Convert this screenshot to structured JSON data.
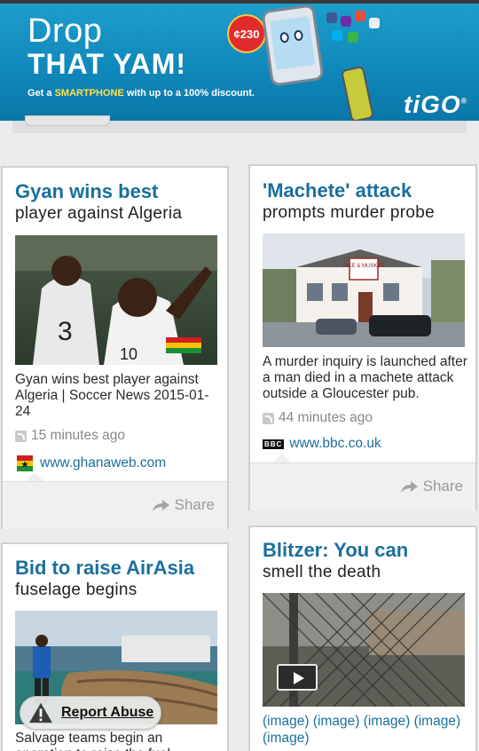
{
  "ad": {
    "headline1": "Drop",
    "headline2": "THAT YAM!",
    "tagline_pre": "Get a",
    "tagline_bold": "SMARTPHONE",
    "tagline_post": "with up to a 100% discount.",
    "price": "¢230",
    "brand": "tiGO",
    "brand_mark": "®"
  },
  "cards": [
    {
      "title": "Gyan wins best",
      "subtitle": "player against Algeria",
      "description": "Gyan wins best player against Algeria | Soccer News 2015-01-24",
      "time": "15 minutes ago",
      "source": "www.ghanaweb.com",
      "share": "Share"
    },
    {
      "title": "'Machete' attack",
      "subtitle": "prompts murder probe",
      "photo_sign": "PIKE & MUSKET",
      "description": "A murder inquiry is launched after a man died in a machete attack outside a Gloucester pub.",
      "time": "44 minutes ago",
      "source_logo": "BBC",
      "source": "www.bbc.co.uk",
      "share": "Share"
    },
    {
      "title": "Bid to raise AirAsia",
      "subtitle": "fuselage begins",
      "description": "Salvage teams begin an operation to raise the fuel..."
    },
    {
      "title": "Blitzer: You can",
      "subtitle": "smell the death",
      "image_links": [
        "(image)",
        "(image)",
        "(image)",
        "(image)",
        "(image)"
      ]
    }
  ],
  "report_abuse": "Report Abuse",
  "colors": {
    "title": "#1a6f9d",
    "link": "#1a6f9d",
    "ad_bg": "#1088bb"
  }
}
